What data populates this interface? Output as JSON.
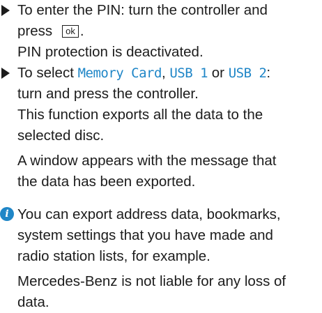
{
  "steps": [
    {
      "line1": "To enter the PIN: turn the controller and",
      "line2_prefix": "press",
      "key_label": "ok",
      "line2_suffix": ".",
      "result": "PIN protection is deactivated."
    },
    {
      "prefix": "To select ",
      "opt1": "Memory Card",
      "sep1": ", ",
      "opt2": "USB 1",
      "sep2": " or ",
      "opt3": "USB 2",
      "suffix": ":",
      "line2": "turn and press the controller.",
      "result1_l1": "This function exports all the data to the",
      "result1_l2": "selected disc.",
      "result2_l1": "A window appears with the message that",
      "result2_l2": "the data has been exported."
    }
  ],
  "note": {
    "icon": "info-icon",
    "l1": "You can export address data, bookmarks,",
    "l2": "system settings that you have made and",
    "l3": "radio station lists, for example.",
    "l4": "Mercedes-Benz is not liable for any loss of",
    "l5": "data."
  },
  "colors": {
    "accent": "#1f86c7",
    "text": "#1c1c1c"
  }
}
